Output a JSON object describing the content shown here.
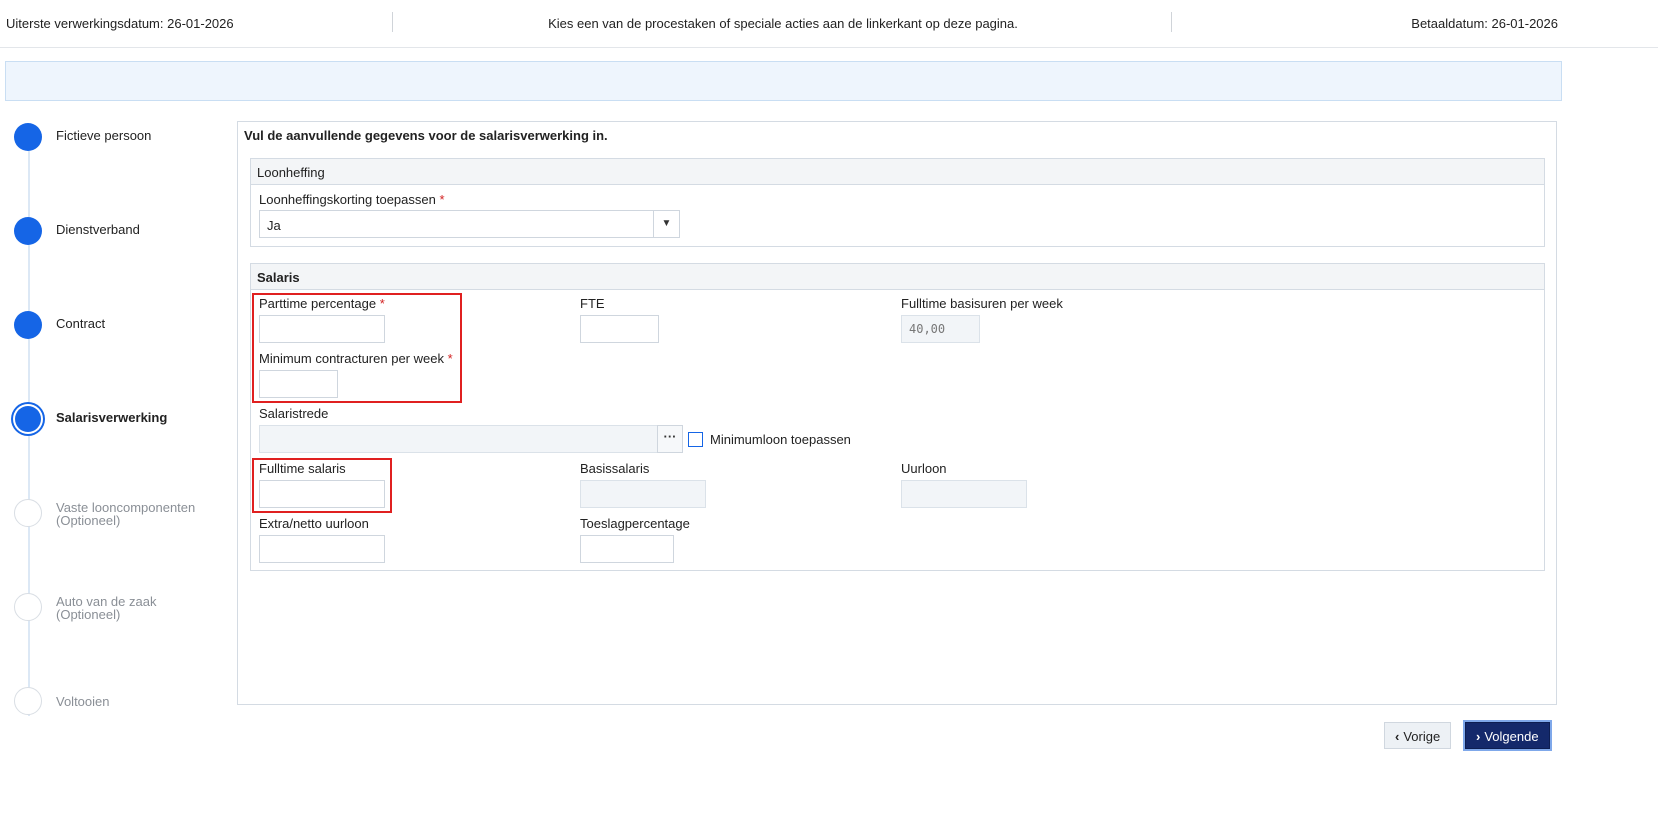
{
  "header": {
    "left": "Uiterste verwerkingsdatum: 26-01-2026",
    "center": "Kies een van de procestaken of speciale acties aan de linkerkant op deze pagina.",
    "right": "Betaaldatum: 26-01-2026"
  },
  "steps": [
    {
      "label": "Fictieve persoon",
      "state": "done"
    },
    {
      "label": "Dienstverband",
      "state": "done"
    },
    {
      "label": "Contract",
      "state": "done"
    },
    {
      "label": "Salarisverwerking",
      "state": "active"
    },
    {
      "label_line1": "Vaste looncomponenten",
      "label_line2": "(Optioneel)",
      "state": "pending"
    },
    {
      "label_line1": "Auto van de zaak",
      "label_line2": "(Optioneel)",
      "state": "pending"
    },
    {
      "label": "Voltooien",
      "state": "pending"
    }
  ],
  "panel": {
    "title": "Vul de aanvullende gegevens voor de salarisverwerking in."
  },
  "loonheffing": {
    "title": "Loonheffing",
    "korting_label": "Loonheffingskorting toepassen",
    "required": "*",
    "korting_value": "Ja"
  },
  "salaris": {
    "title": "Salaris",
    "parttime_label": "Parttime percentage",
    "fte_label": "FTE",
    "fulltime_basisuren_label": "Fulltime basisuren per week",
    "fulltime_basisuren_value": "40,00",
    "min_contracturen_label": "Minimum contracturen per week",
    "salaristrede_label": "Salaristrede",
    "lookup_glyph": "···",
    "minimumloon_label": "Minimumloon toepassen",
    "fulltime_salaris_label": "Fulltime salaris",
    "basissalaris_label": "Basissalaris",
    "uurloon_label": "Uurloon",
    "extra_netto_label": "Extra/netto uurloon",
    "toeslag_label": "Toeslagpercentage"
  },
  "nav": {
    "prev_label": "Vorige",
    "next_label": "Volgende"
  },
  "colors": {
    "accent": "#1565e6",
    "primary_button": "#14296b",
    "required": "#d21f1f",
    "highlight": "#e02020"
  }
}
